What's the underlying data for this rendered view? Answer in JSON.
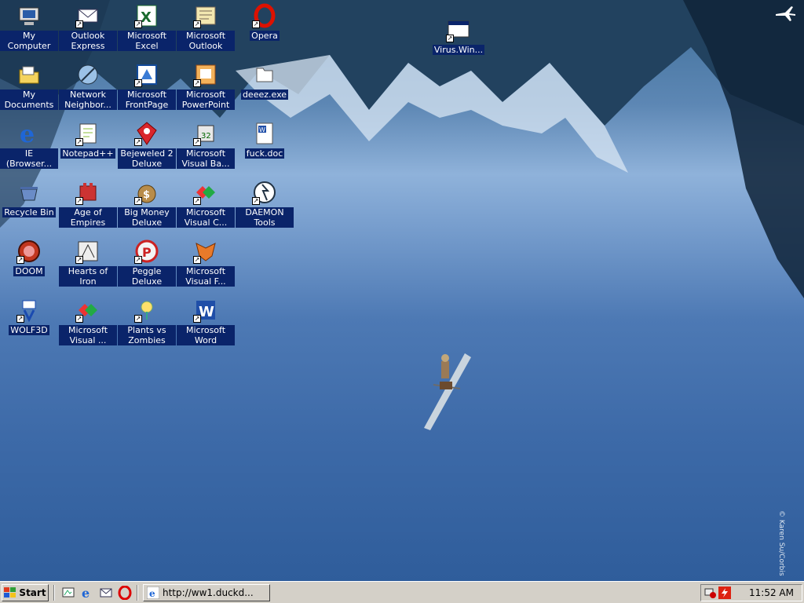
{
  "desktop": {
    "icons": [
      {
        "label": "My Computer",
        "icon": "my-computer-icon"
      },
      {
        "label": "Outlook Express",
        "icon": "outlook-express-icon"
      },
      {
        "label": "Microsoft Excel",
        "icon": "excel-icon"
      },
      {
        "label": "Microsoft Outlook",
        "icon": "outlook-icon"
      },
      {
        "label": "Opera",
        "icon": "opera-icon"
      },
      {
        "label": "My Documents",
        "icon": "my-documents-icon"
      },
      {
        "label": "Network Neighbor...",
        "icon": "network-neighborhood-icon"
      },
      {
        "label": "Microsoft FrontPage",
        "icon": "frontpage-icon"
      },
      {
        "label": "Microsoft PowerPoint",
        "icon": "powerpoint-icon"
      },
      {
        "label": "deeez.exe",
        "icon": "exe-file-icon"
      },
      {
        "label": "IE (Browser...",
        "icon": "internet-explorer-icon"
      },
      {
        "label": "Notepad++",
        "icon": "notepad-plus-icon"
      },
      {
        "label": "Bejeweled 2 Deluxe",
        "icon": "bejeweled-icon"
      },
      {
        "label": "Microsoft Visual Ba...",
        "icon": "visual-basic-icon"
      },
      {
        "label": "fuck.doc",
        "icon": "word-document-icon"
      },
      {
        "label": "Recycle Bin",
        "icon": "recycle-bin-icon"
      },
      {
        "label": "Age of Empires",
        "icon": "age-of-empires-icon"
      },
      {
        "label": "Big Money Deluxe",
        "icon": "big-money-icon"
      },
      {
        "label": "Microsoft Visual C...",
        "icon": "visual-c-icon"
      },
      {
        "label": "DAEMON Tools",
        "icon": "daemon-tools-icon"
      },
      {
        "label": "DOOM",
        "icon": "doom-icon"
      },
      {
        "label": "Hearts of Iron",
        "icon": "hearts-of-iron-icon"
      },
      {
        "label": "Peggle Deluxe",
        "icon": "peggle-icon"
      },
      {
        "label": "Microsoft Visual F...",
        "icon": "visual-foxpro-icon"
      },
      {
        "label": "WOLF3D",
        "icon": "wolf3d-icon"
      },
      {
        "label": "Microsoft Visual ...",
        "icon": "visual-studio-icon"
      },
      {
        "label": "Plants vs Zombies",
        "icon": "plants-vs-zombies-icon"
      },
      {
        "label": "Microsoft Word",
        "icon": "word-icon"
      },
      {
        "label": "Virus.Win...",
        "icon": "program-window-icon"
      }
    ],
    "credit": "© Karen Su/Corbis"
  },
  "taskbar": {
    "start_label": "Start",
    "quick_launch": [
      "desktop-icon",
      "internet-explorer-icon",
      "outlook-express-icon",
      "opera-icon"
    ],
    "task_button_label": "http://ww1.duckd...",
    "clock": "11:52 AM"
  }
}
